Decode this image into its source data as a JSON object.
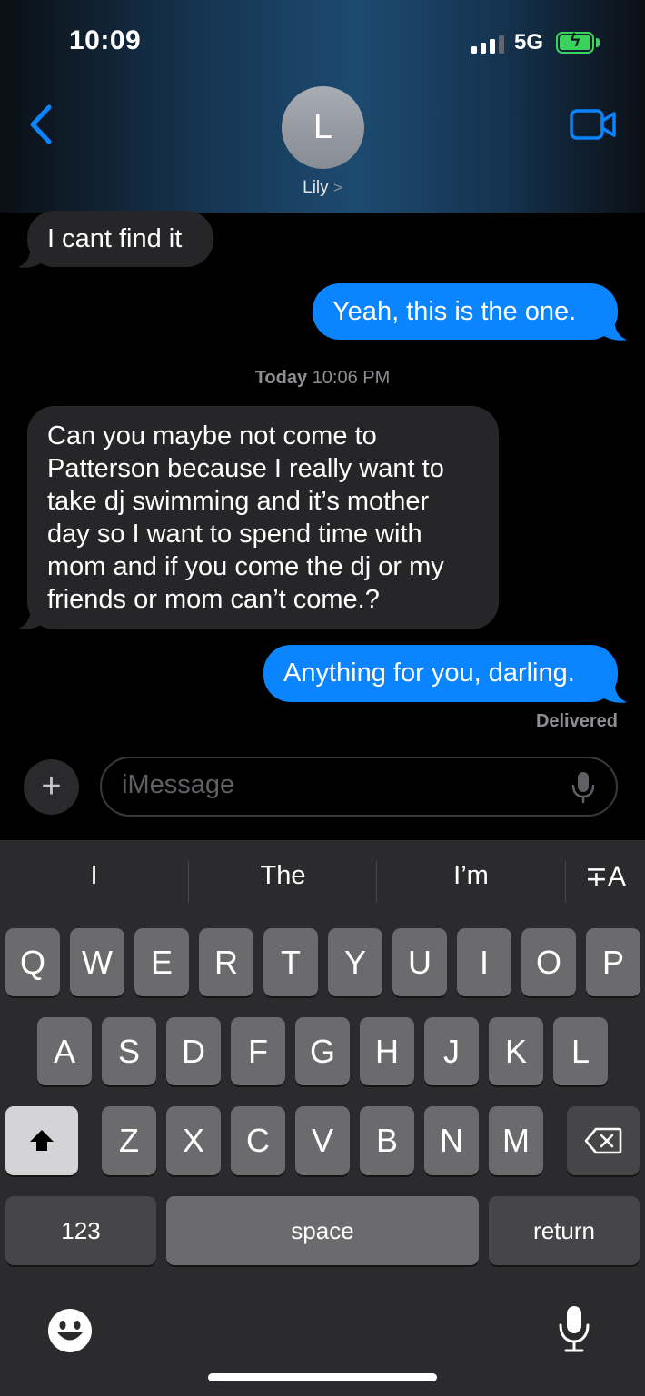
{
  "status_bar": {
    "time": "10:09",
    "network": "5G"
  },
  "header": {
    "avatar_initial": "L",
    "contact_name": "Lily",
    "contact_chevron": ">"
  },
  "messages": [
    {
      "direction": "incoming",
      "text": "I cant find it"
    },
    {
      "direction": "outgoing",
      "text": "Yeah, this is the one."
    },
    {
      "direction": "incoming",
      "lines": [
        "Can you maybe not come to",
        "Patterson because I really want to",
        "take dj swimming and it’s mother",
        "day so I want to spend time with",
        "mom and if you come the dj or my",
        "friends or mom can’t come.?"
      ]
    },
    {
      "direction": "outgoing",
      "text": "Anything for you, darling."
    }
  ],
  "timestamp": {
    "day": "Today",
    "time": "10:06 PM"
  },
  "status": "Delivered",
  "composer": {
    "plus_label": "+",
    "placeholder": "iMessage"
  },
  "keyboard": {
    "suggestions": [
      "I",
      "The",
      "I’m"
    ],
    "format_label": "∓A",
    "row1": [
      "Q",
      "W",
      "E",
      "R",
      "T",
      "Y",
      "U",
      "I",
      "O",
      "P"
    ],
    "row2": [
      "A",
      "S",
      "D",
      "F",
      "G",
      "H",
      "J",
      "K",
      "L"
    ],
    "row3": [
      "Z",
      "X",
      "C",
      "V",
      "B",
      "N",
      "M"
    ],
    "numbers_label": "123",
    "space_label": "space",
    "return_label": "return"
  },
  "icons": {
    "back": "chevron-left-icon",
    "video": "video-camera-icon",
    "mic": "microphone-icon",
    "shift": "shift-arrow-icon",
    "delete": "backspace-icon",
    "emoji": "emoji-icon"
  },
  "colors": {
    "accent": "#0a84ff",
    "incoming_bubble": "#262629",
    "battery": "#3ad35d"
  }
}
